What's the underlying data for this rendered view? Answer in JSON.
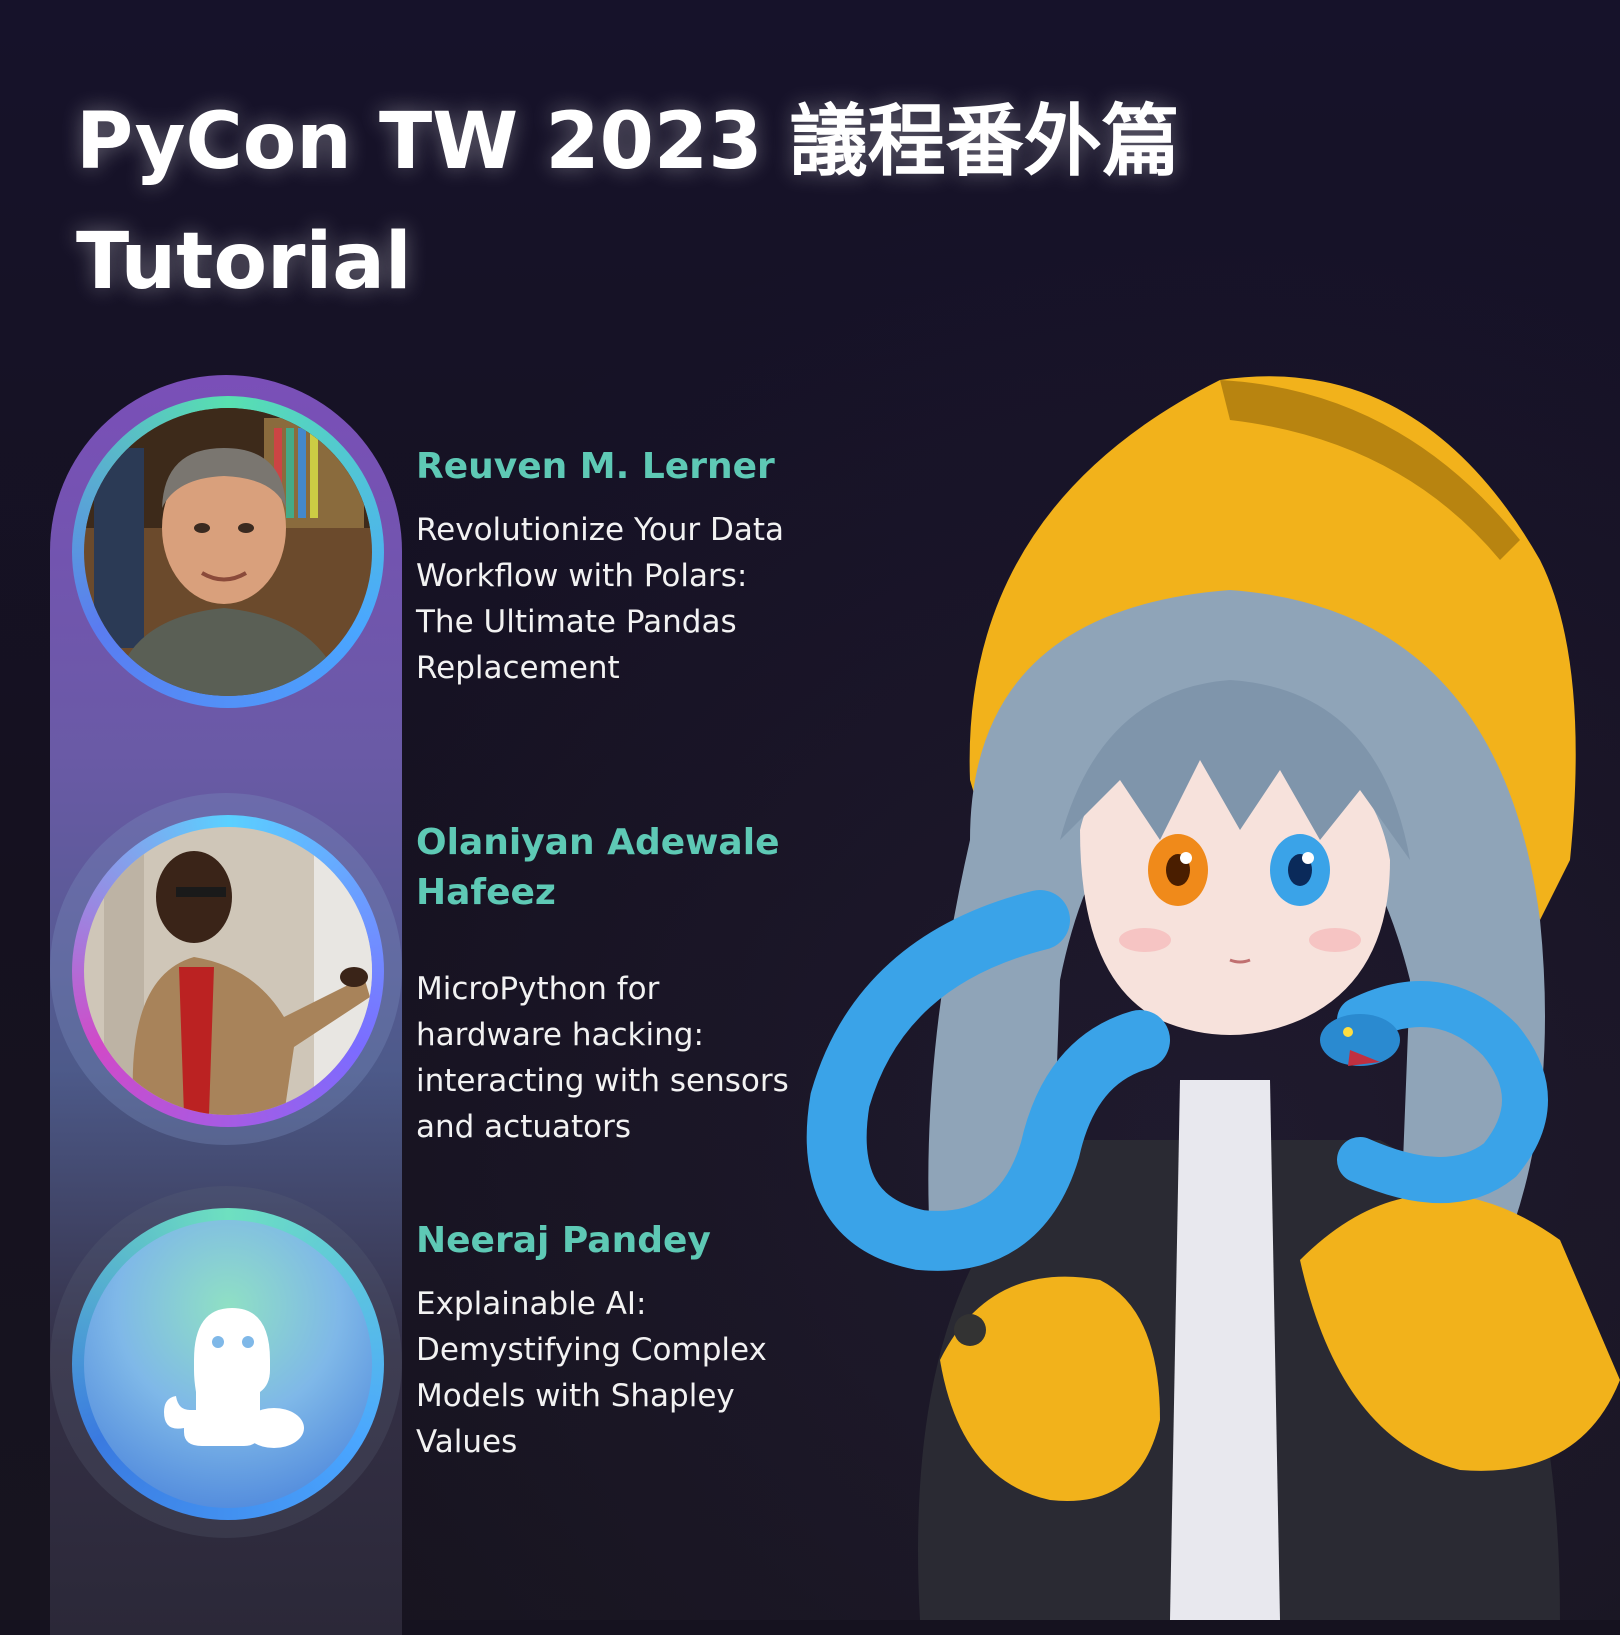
{
  "title": {
    "line1": "PyCon TW 2023 議程番外篇",
    "line2": "Tutorial"
  },
  "speakers": [
    {
      "name": "Reuven M. Lerner",
      "talk": "Revolutionize Your Data Workflow with Polars: The Ultimate Pandas Replacement",
      "avatar": "photo"
    },
    {
      "name": "Olaniyan Adewale Hafeez",
      "talk": "MicroPython for hardware hacking: interacting with sensors and actuators",
      "avatar": "photo"
    },
    {
      "name": "Neeraj Pandey",
      "talk": "Explainable AI: Demystifying Complex Models with Shapley Values",
      "avatar": "snake-mascot-icon"
    }
  ],
  "colors": {
    "background": "#15121f",
    "name_accent": "#5ec9b5",
    "hood_yellow": "#f2b21b",
    "snake_blue": "#3aa3e8"
  }
}
